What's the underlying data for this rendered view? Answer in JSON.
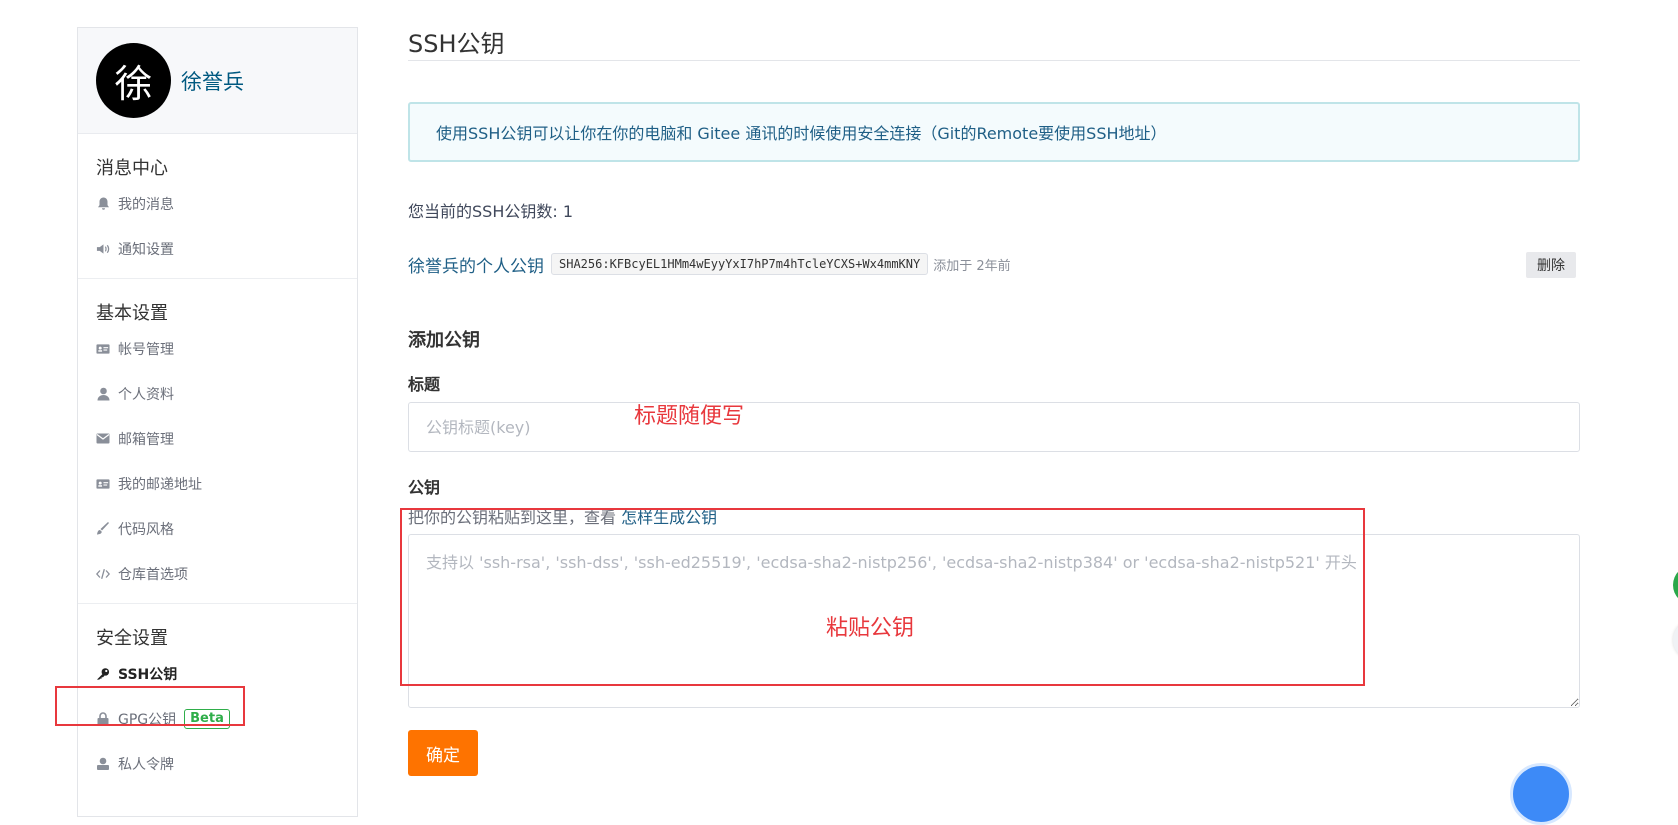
{
  "user": {
    "avatar_char": "徐",
    "name": "徐誉兵"
  },
  "sidebar": {
    "groups": [
      {
        "title": "消息中心",
        "items": [
          {
            "label": "我的消息",
            "icon": "bell-icon"
          },
          {
            "label": "通知设置",
            "icon": "speaker-icon"
          }
        ]
      },
      {
        "title": "基本设置",
        "items": [
          {
            "label": "帐号管理",
            "icon": "id-card-icon"
          },
          {
            "label": "个人资料",
            "icon": "user-icon"
          },
          {
            "label": "邮箱管理",
            "icon": "envelope-icon"
          },
          {
            "label": "我的邮递地址",
            "icon": "id-card-icon"
          },
          {
            "label": "代码风格",
            "icon": "brush-icon"
          },
          {
            "label": "仓库首选项",
            "icon": "code-icon"
          }
        ]
      },
      {
        "title": "安全设置",
        "items": [
          {
            "label": "SSH公钥",
            "icon": "key-icon",
            "active": true
          },
          {
            "label": "GPG公钥",
            "icon": "lock-icon",
            "badge": "Beta"
          },
          {
            "label": "私人令牌",
            "icon": "token-icon"
          }
        ]
      }
    ]
  },
  "main": {
    "title": "SSH公钥",
    "info": "使用SSH公钥可以让你在你的电脑和 Gitee 通讯的时候使用安全连接（Git的Remote要使用SSH地址）",
    "count_line": "您当前的SSH公钥数: 1",
    "key": {
      "name": "徐誉兵的个人公钥",
      "fingerprint": "SHA256:KFBcyEL1HMm4wEyyYxI7hP7m4hTcleYCXS+Wx4mmKNY",
      "added": "添加于 2年前",
      "delete_label": "删除"
    },
    "add_section_title": "添加公钥",
    "title_label": "标题",
    "title_placeholder": "公钥标题(key)",
    "pubkey_label": "公钥",
    "hint_text": "把你的公钥粘贴到这里，查看 ",
    "hint_link": "怎样生成公钥",
    "pubkey_placeholder": "支持以 'ssh-rsa', 'ssh-dss', 'ssh-ed25519', 'ecdsa-sha2-nistp256', 'ecdsa-sha2-nistp384' or 'ecdsa-sha2-nistp521' 开头",
    "submit_label": "确定"
  },
  "annotations": {
    "title_note": "标题随便写",
    "pubkey_note": "粘贴公钥",
    "color": "#e8383d"
  },
  "colors": {
    "accent": "#fe7300",
    "link": "#1f5f86",
    "beta": "#2fae4a"
  }
}
